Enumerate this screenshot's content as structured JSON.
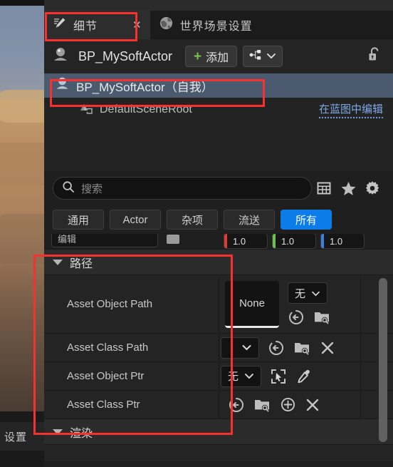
{
  "viewport": {
    "settings_label": "设置"
  },
  "tabs": [
    {
      "label": "细节",
      "icon": "pencil-details-icon",
      "active": true,
      "closable": true,
      "close_glyph": "✕"
    },
    {
      "label": "世界场景设置",
      "icon": "globe-icon",
      "active": false,
      "closable": false
    }
  ],
  "actorbar": {
    "icon": "actor-icon",
    "name": "BP_MySoftActor",
    "add_label": "添加",
    "add_plus": "+",
    "blueprint_icon": "blueprint-graph-icon",
    "chevron": "chevron-down-icon",
    "lock_icon": "unlock-icon"
  },
  "tree": {
    "rows": [
      {
        "label": "BP_MySoftActor（自我）",
        "icon": "actor-icon",
        "selected": true,
        "link": ""
      },
      {
        "label": "DefaultSceneRoot",
        "icon": "scene-root-icon",
        "selected": false,
        "link": "在蓝图中编辑"
      }
    ]
  },
  "search": {
    "placeholder": "搜索",
    "value": "",
    "icon": "search-icon",
    "tools": [
      {
        "name": "table-view-icon",
        "glyph": "table"
      },
      {
        "name": "favorite-star-icon",
        "glyph": "star"
      },
      {
        "name": "settings-gear-icon",
        "glyph": "gear"
      }
    ]
  },
  "filters": [
    {
      "label": "通用",
      "active": false
    },
    {
      "label": "Actor",
      "active": false
    },
    {
      "label": "杂项",
      "active": false
    },
    {
      "label": "流送",
      "active": false
    },
    {
      "label": "所有",
      "active": true
    }
  ],
  "clipped_row": {
    "combo_value": "编辑",
    "rgb": [
      {
        "value": "1.0",
        "color": "#e03b2e"
      },
      {
        "value": "1.0",
        "color": "#6bc44a"
      },
      {
        "value": "1.0",
        "color": "#3b82e0"
      }
    ]
  },
  "sections": [
    {
      "name": "path-section",
      "title": "路径",
      "expanded": true,
      "rows": [
        {
          "name": "Asset Object Path",
          "value_box": "None",
          "dropdown": "无",
          "icons": [
            "browse-back-icon",
            "folder-search-icon"
          ]
        },
        {
          "name": "Asset Class Path",
          "value_box": "",
          "dropdown": "",
          "icons": [
            "chevron-down-icon",
            "browse-back-icon",
            "folder-search-icon",
            "clear-x-icon"
          ]
        },
        {
          "name": "Asset Object Ptr",
          "value_box": "",
          "dropdown": "无",
          "icons": [
            "picker-target-icon",
            "eyedropper-icon"
          ]
        },
        {
          "name": "Asset Class Ptr",
          "value_box": "",
          "dropdown": "",
          "icons": [
            "browse-back-icon",
            "folder-search-icon",
            "add-plus-icon",
            "clear-x-icon"
          ]
        }
      ]
    },
    {
      "name": "render-section",
      "title": "渲染",
      "expanded": true,
      "rows": []
    }
  ],
  "colors": {
    "accent_blue": "#0c7ce8",
    "selection": "#4b5a6e",
    "link": "#7ea9e8",
    "annotation": "#f8302e",
    "panel_bg": "#1f1f1f"
  }
}
